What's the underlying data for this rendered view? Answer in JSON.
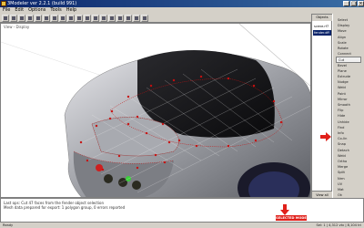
{
  "window": {
    "title": "3Modeler ver 2.2.1 (build 991)",
    "controls": [
      "_",
      "□",
      "×"
    ]
  },
  "menu": [
    "File",
    "Edit",
    "Options",
    "Tools",
    "Help"
  ],
  "viewport": {
    "label": "View - Display"
  },
  "outliner": {
    "header": "Objects",
    "items": [
      "scene.rf7",
      "fender.dff"
    ],
    "bottom_label": "View all"
  },
  "commands": [
    "Select",
    "Display",
    "Move",
    "Align",
    "Scale",
    "Rotate",
    "Connect",
    "Cut",
    "Bevel",
    "Plane",
    "Extrude",
    "Nudge",
    "Weld",
    "Paint",
    "Mirror",
    "Smooth",
    "Flip",
    "Hide",
    "Unhide",
    "Find",
    "Info",
    "Co-lin",
    "Snap",
    "Detach",
    "Weld",
    "Ortho",
    "Merge",
    "Split",
    "Nrm",
    "UV",
    "Mat",
    "Ok"
  ],
  "selected_command": "Cut",
  "console": {
    "lines": [
      "Last ops: Cut 47 faces from the fender object selection",
      "Mesh data prepared for export: 1 polygon group, 0 errors reported"
    ]
  },
  "status": {
    "text": "Ready",
    "coords": "Sel: 1 | 4,312 vtx | 8,104 tri",
    "selection_badge": "SELECTED MODE"
  },
  "colors": {
    "accent": "#0a246a",
    "annotation_red": "#e0201a",
    "wire_red": "#c81010"
  }
}
